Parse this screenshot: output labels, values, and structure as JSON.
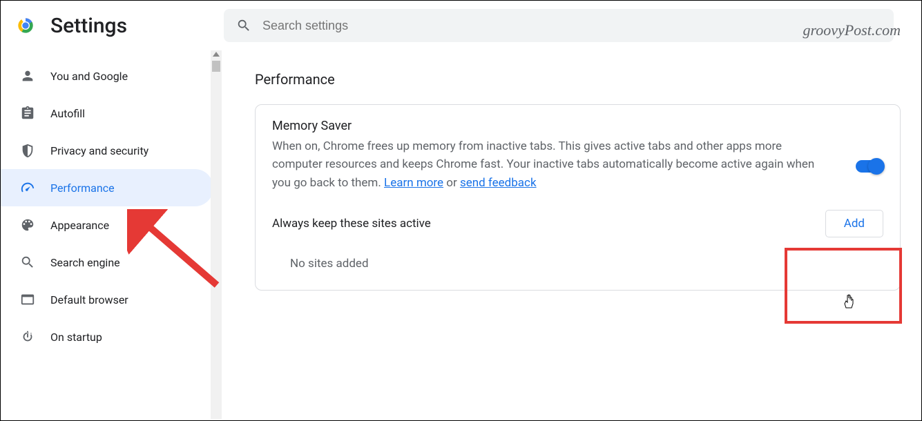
{
  "header": {
    "title": "Settings",
    "search_placeholder": "Search settings"
  },
  "watermark": "groovyPost.com",
  "sidebar": {
    "items": [
      {
        "label": "You and Google",
        "icon": "person-icon"
      },
      {
        "label": "Autofill",
        "icon": "clipboard-icon"
      },
      {
        "label": "Privacy and security",
        "icon": "shield-icon"
      },
      {
        "label": "Performance",
        "icon": "gauge-icon",
        "active": true
      },
      {
        "label": "Appearance",
        "icon": "palette-icon"
      },
      {
        "label": "Search engine",
        "icon": "search-icon"
      },
      {
        "label": "Default browser",
        "icon": "browser-icon"
      },
      {
        "label": "On startup",
        "icon": "power-icon"
      }
    ]
  },
  "main": {
    "section_title": "Performance",
    "memory_saver": {
      "title": "Memory Saver",
      "description_pre": "When on, Chrome frees up memory from inactive tabs. This gives active tabs and other apps more computer resources and keeps Chrome fast. Your inactive tabs automatically become active again when you go back to them. ",
      "learn_more": "Learn more",
      "or_text": " or ",
      "send_feedback": "send feedback",
      "toggle_on": true
    },
    "always_active": {
      "title": "Always keep these sites active",
      "add_label": "Add",
      "empty": "No sites added"
    }
  }
}
